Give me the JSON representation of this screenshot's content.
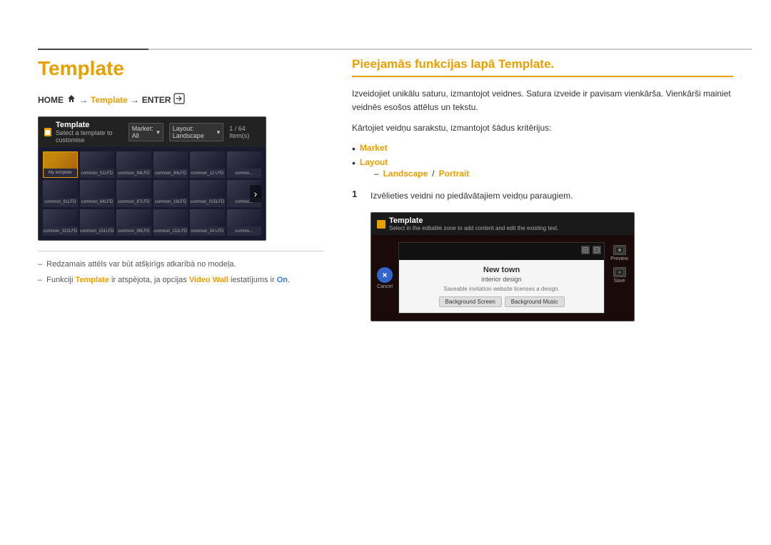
{
  "page": {
    "title": "Template",
    "top_divider_accent_color": "#444",
    "top_divider_color": "#ccc"
  },
  "breadcrumb": {
    "home": "HOME",
    "arrow1": "→",
    "template": "Template",
    "arrow2": "→",
    "enter": "ENTER"
  },
  "template_ui_left": {
    "title": "Template",
    "subtitle": "Select a template to customise",
    "market_label": "Market: All",
    "layout_label": "Layout: Landscape",
    "count": "1 / 64 Item(s)",
    "grid_items": [
      {
        "label": "My template",
        "type": "folder"
      },
      {
        "label": "common_51LFD",
        "type": "dark"
      },
      {
        "label": "common_94LFD",
        "type": "dark"
      },
      {
        "label": "common_94LFD",
        "type": "dark"
      },
      {
        "label": "common_12 LFD",
        "type": "dark"
      },
      {
        "label": "common...",
        "type": "dark"
      },
      {
        "label": "common_81LFD",
        "type": "dark"
      },
      {
        "label": "common_84LFD",
        "type": "dark"
      },
      {
        "label": "common_87LFD",
        "type": "dark"
      },
      {
        "label": "common_18LFD",
        "type": "dark"
      },
      {
        "label": "common_015LFD",
        "type": "dark"
      },
      {
        "label": "common...",
        "type": "dark"
      },
      {
        "label": "common_322LFD",
        "type": "dark"
      },
      {
        "label": "common_151LFD",
        "type": "dark"
      },
      {
        "label": "common_98LFD",
        "type": "dark"
      },
      {
        "label": "common_211LFD",
        "type": "dark"
      },
      {
        "label": "common_24 LFD",
        "type": "dark"
      },
      {
        "label": "common...",
        "type": "dark"
      }
    ]
  },
  "notes": [
    {
      "dash": "–",
      "text_before": "Redzamais attēls var būt atšķirīgs atkarībā no modeļa."
    },
    {
      "dash": "–",
      "text_before": "Funkciji ",
      "highlight1": "Template",
      "text_middle": " ir atspējota, ja opcijas ",
      "highlight2": "Video Wall",
      "text_end": " iestatījums ir ",
      "highlight3": "On",
      "text_final": "."
    }
  ],
  "right_section": {
    "title": "Pieejamās funkcijas lapā Template.",
    "description1": "Izveidojiet unikālu saturu, izmantojot veidnes. Satura izveide ir pavisam vienkārša. Vienkārši mainiet veidnēs esošos attēlus un tekstu.",
    "description2": "Kārtojiet veidņu sarakstu, izmantojot šādus kritērijus:",
    "bullets": [
      {
        "label": "Market",
        "sub": null
      },
      {
        "label": "Layout",
        "sub": {
          "part1": "Landscape",
          "sep": "/",
          "part2": "Portrait"
        }
      }
    ],
    "step1_num": "1",
    "step1_text": "Izvēlieties veidni no piedāvātajiem veidņu paraugiem.",
    "template_ui_large": {
      "title": "Template",
      "subtitle": "Select in the editable zone to add content and edit the existing text.",
      "cancel_label": "Cancel",
      "preview_label": "Preview",
      "save_label": "Save",
      "overlay_title": "New town",
      "overlay_subtitle": "interior design",
      "overlay_desc": "Saveable invitation website licenses a design.",
      "btn1": "Background Screen",
      "btn2": "Background Music"
    }
  }
}
